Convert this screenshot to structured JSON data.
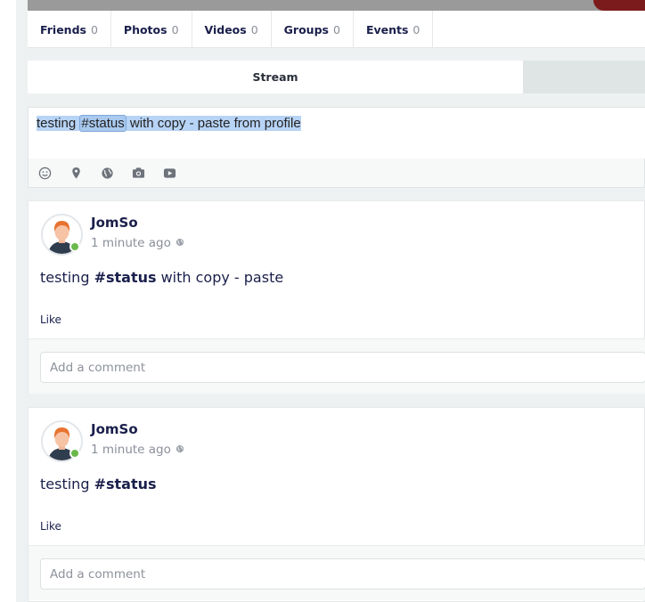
{
  "profile_tabs": [
    {
      "label": "Friends",
      "count": "0"
    },
    {
      "label": "Photos",
      "count": "0"
    },
    {
      "label": "Videos",
      "count": "0"
    },
    {
      "label": "Groups",
      "count": "0"
    },
    {
      "label": "Events",
      "count": "0"
    }
  ],
  "stream": {
    "tab_label": "Stream"
  },
  "composer": {
    "text_before": "testing ",
    "hashtag": "#status",
    "text_after": " with copy - paste from profile",
    "tools": [
      "smiley-icon",
      "location-pin-icon",
      "globe-icon",
      "camera-icon",
      "video-icon"
    ]
  },
  "posts": [
    {
      "author": "JomSo",
      "time": "1 minute ago",
      "text_before": "testing ",
      "hashtag": "#status",
      "text_after": " with copy - paste",
      "like_label": "Like",
      "comment_placeholder": "Add a comment"
    },
    {
      "author": "JomSo",
      "time": "1 minute ago",
      "text_before": "testing ",
      "hashtag": "#status",
      "text_after": "",
      "like_label": "Like",
      "comment_placeholder": "Add a comment"
    }
  ],
  "colors": {
    "accent": "#1a1f4b",
    "online": "#6ab84a",
    "selection": "#b7d3f5",
    "cover_red": "#7c1b1b"
  }
}
